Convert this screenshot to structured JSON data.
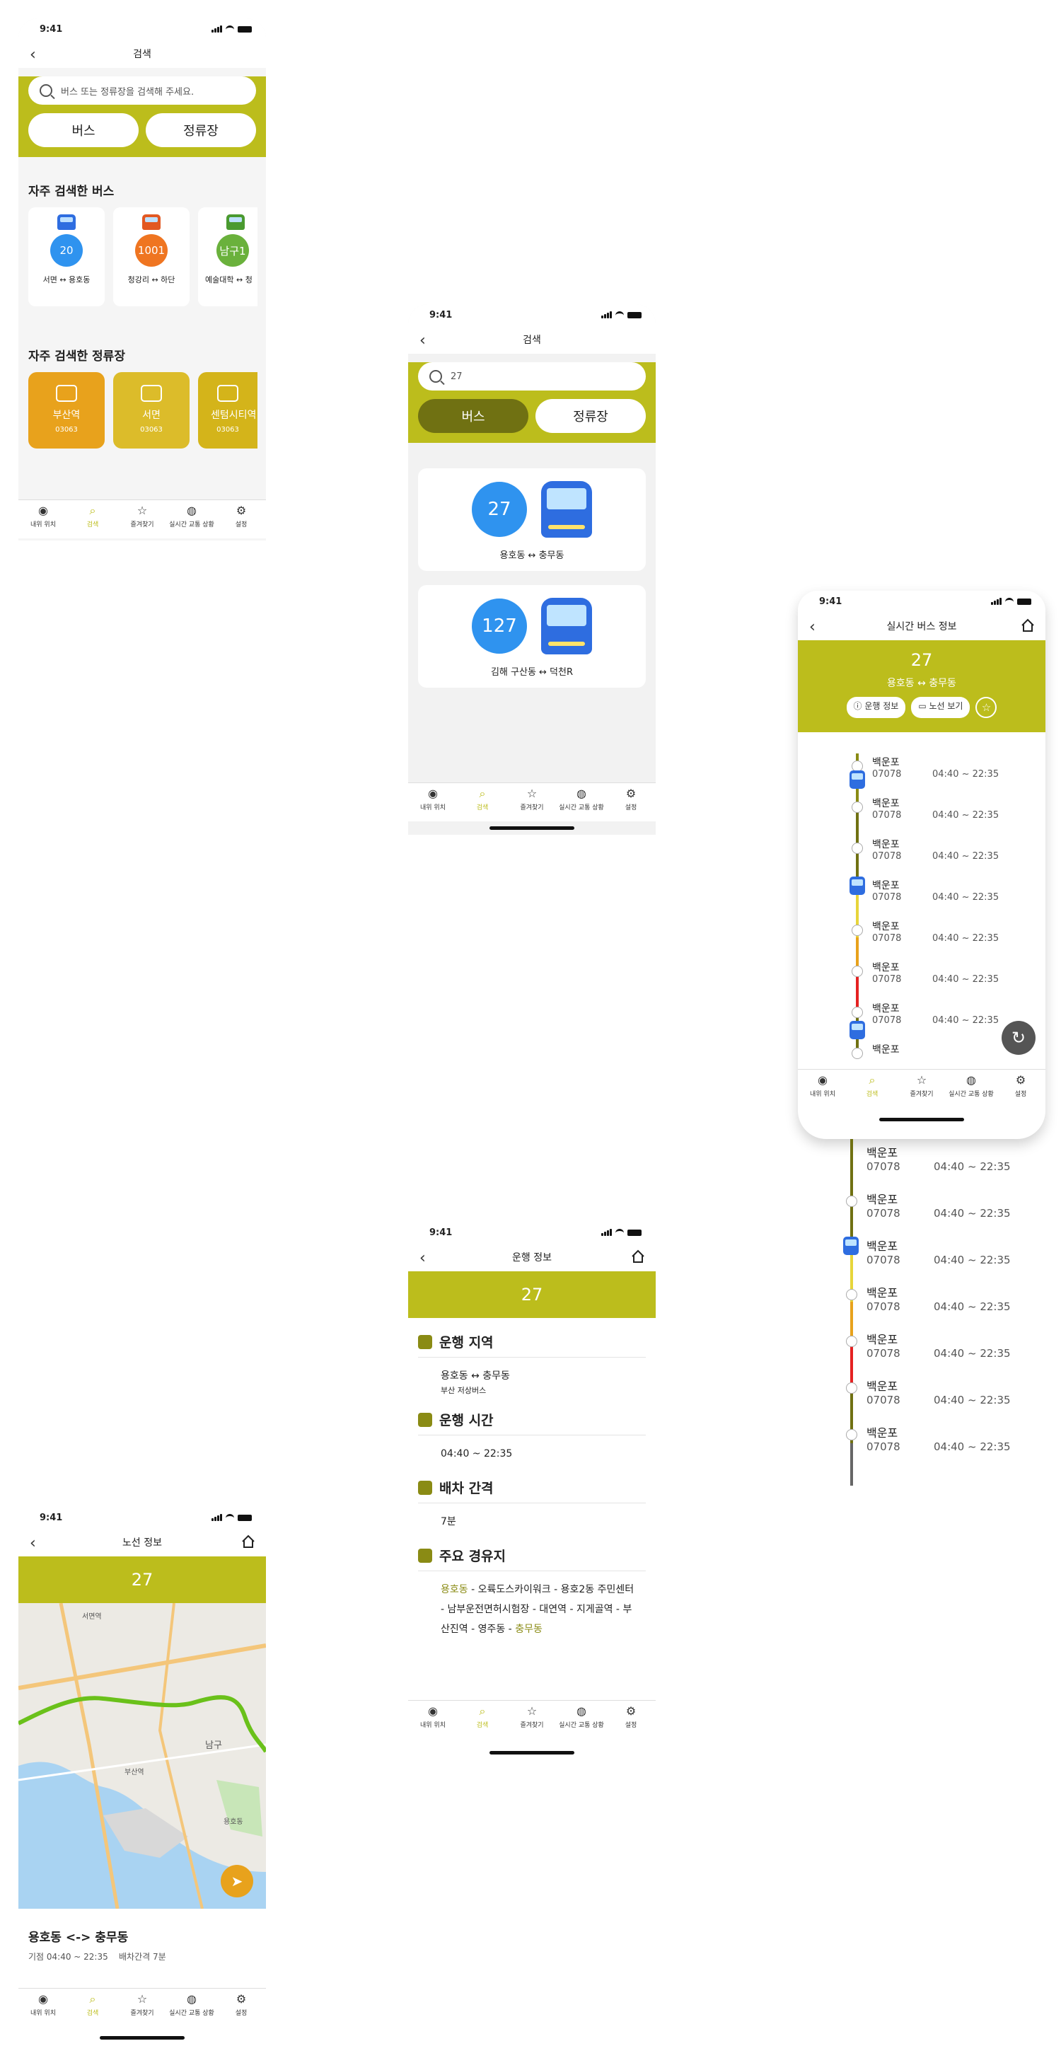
{
  "colors": {
    "accent": "#bcbd1c",
    "accent_dark": "#707112",
    "blue": "#2f93ef",
    "orange": "#ef7521",
    "green": "#6ab13c"
  },
  "status": {
    "time": "9:41"
  },
  "tabbar": [
    {
      "label": "내위 위치",
      "icon": "person-pin-icon"
    },
    {
      "label": "검색",
      "icon": "search-icon"
    },
    {
      "label": "즐겨찾기",
      "icon": "star-icon"
    },
    {
      "label": "실시간 교통 상황",
      "icon": "globe-icon"
    },
    {
      "label": "설정",
      "icon": "gear-icon"
    }
  ],
  "screen1": {
    "title": "검색",
    "search_placeholder": "버스 또는 정류장을 검색해 주세요.",
    "seg_bus": "버스",
    "seg_stop": "정류장",
    "freq_bus_title": "자주 검색한 버스",
    "freq_buses": [
      {
        "num": "20",
        "route": "서면 ↔ 용호동",
        "color": "#2f93ef"
      },
      {
        "num": "1001",
        "route": "청강리 ↔ 하단",
        "color": "#ef7521"
      },
      {
        "num": "남구1",
        "route": "예술대학 ↔ 청",
        "color": "#6ab13c"
      }
    ],
    "freq_stop_title": "자주 검색한 정류장",
    "freq_stops": [
      {
        "name": "부산역",
        "code": "03063",
        "color": "#e8a21c"
      },
      {
        "name": "서면",
        "code": "03063",
        "color": "#dcbc2a"
      },
      {
        "name": "센텀시티역",
        "code": "03063",
        "color": "#d4b41a"
      }
    ]
  },
  "screen2": {
    "title": "검색",
    "search_value": "27",
    "seg_bus": "버스",
    "seg_stop": "정류장",
    "results": [
      {
        "num": "27",
        "route": "용호동 ↔ 충무동"
      },
      {
        "num": "127",
        "route": "김해 구산동 ↔ 덕천R"
      }
    ]
  },
  "screen3": {
    "title": "실시간 버스 정보",
    "num": "27",
    "route": "용호동 ↔ 충무동",
    "btn_info": "운행 정보",
    "btn_route": "노선 보기",
    "stops": [
      {
        "name": "백운포",
        "code": "07078",
        "time": "04:40 ~ 22:35"
      },
      {
        "name": "백운포",
        "code": "07078",
        "time": "04:40 ~ 22:35"
      },
      {
        "name": "백운포",
        "code": "07078",
        "time": "04:40 ~ 22:35"
      },
      {
        "name": "백운포",
        "code": "07078",
        "time": "04:40 ~ 22:35"
      },
      {
        "name": "백운포",
        "code": "07078",
        "time": "04:40 ~ 22:35"
      },
      {
        "name": "백운포",
        "code": "07078",
        "time": "04:40 ~ 22:35"
      },
      {
        "name": "백운포",
        "code": "07078",
        "time": "04:40 ~ 22:35"
      },
      {
        "name": "백운포",
        "code": "07078",
        "time": "04:40 ~ 22:35"
      }
    ],
    "stops_ext": [
      {
        "name": "백운포",
        "code": "07078",
        "time": "04:40 ~ 22:35"
      },
      {
        "name": "백운포",
        "code": "07078",
        "time": "04:40 ~ 22:35"
      },
      {
        "name": "백운포",
        "code": "07078",
        "time": "04:40 ~ 22:35"
      },
      {
        "name": "백운포",
        "code": "07078",
        "time": "04:40 ~ 22:35"
      },
      {
        "name": "백운포",
        "code": "07078",
        "time": "04:40 ~ 22:35"
      },
      {
        "name": "백운포",
        "code": "07078",
        "time": "04:40 ~ 22:35"
      },
      {
        "name": "백운포",
        "code": "07078",
        "time": "04:40 ~ 22:35"
      }
    ]
  },
  "screen4": {
    "title": "운행 정보",
    "num": "27",
    "s1_title": "운행 지역",
    "s1_route": "용호동 ↔ 충무동",
    "s1_sub": "부산 저상버스",
    "s2_title": "운행 시간",
    "s2_value": "04:40 ~ 22:35",
    "s3_title": "배차 간격",
    "s3_value": "7분",
    "s4_title": "주요 경유지",
    "s4_first": "용호동",
    "s4_middle": " - 오륙도스카이워크 - 용호2동 주민센터 - 남부운전면허시험장 - 대연역 - 지게골역 - 부산진역 - 영주동 - ",
    "s4_last": "충무동"
  },
  "screen5": {
    "title": "노선 정보",
    "num": "27",
    "route": "용호동 <-> 충무동",
    "meta": "기점 04:40 ~ 22:35    배차간격 7분",
    "map_labels": [
      "남구",
      "서면역",
      "부산역",
      "용호동"
    ]
  }
}
